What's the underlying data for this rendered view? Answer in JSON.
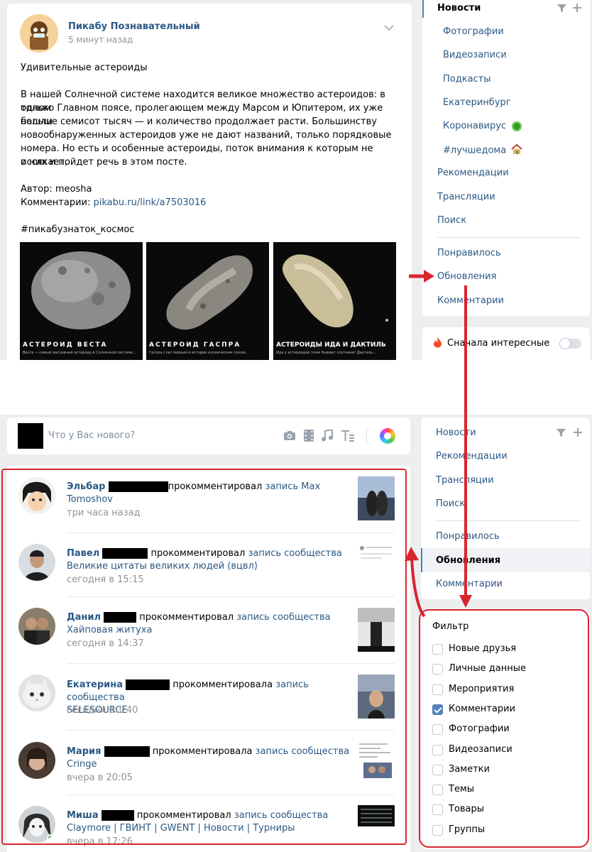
{
  "post": {
    "author": "Пикабу Познавательный",
    "time": "5 минут назад",
    "title": "Удивительные астероиды",
    "body_lines": [
      "В нашей Солнечной системе находится великое множество астероидов: в одном",
      "только Главном поясе, пролегающем между Марсом и Юпитером, их уже нашли",
      "больше семисот тысяч — и количество продолжает расти. Большинству",
      "новообнаруженных астероидов уже не дают названий, только порядковые",
      "номера. Но есть и особенные астероиды, поток внимания к которым не иссякает,",
      "о них и пойдет речь в этом посте."
    ],
    "author_label": "Автор: meosha",
    "comments_label": "Комментарии: ",
    "comments_link": "pikabu.ru/link/a7503016",
    "hashtag": "#пикабузнаток_космос",
    "images": [
      {
        "caption": "АСТЕРОИД ВЕСТА",
        "sub": "Веста — самый массивный астероид в Солнечной системе..."
      },
      {
        "caption": "АСТЕРОИД ГАСПРА",
        "sub": "Гаспра стал первым в истории космическим телом..."
      },
      {
        "caption": "АСТЕРОИДЫ ИДА И ДАКТИЛЬ",
        "sub": "Ида у астероидов тоже бывают спутники! Дактиль..."
      }
    ]
  },
  "top_menu": {
    "news": "Новости",
    "sub_items": [
      "Фотографии",
      "Видеозаписи",
      "Подкасты",
      "Екатеринбург",
      "Коронавирус",
      "#лучшедома"
    ],
    "items": [
      "Рекомендации",
      "Трансляции",
      "Поиск"
    ],
    "items2": [
      "Понравилось",
      "Обновления",
      "Комментарии"
    ],
    "toggle_label": "Сначала интересные"
  },
  "composer": {
    "placeholder": "Что у Вас нового?"
  },
  "side_menu": {
    "news": "Новости",
    "items": [
      "Рекомендации",
      "Трансляции",
      "Поиск"
    ],
    "items2": [
      "Понравилось",
      "Обновления",
      "Комментарии"
    ],
    "active": "Обновления"
  },
  "feed": [
    {
      "name": "Эльбар",
      "action": "прокомментировал",
      "link1": "запись Max",
      "link2": "Tomoshov",
      "time": "три часа назад"
    },
    {
      "name": "Павел",
      "action": "прокомментировал",
      "link1": "запись сообщества",
      "link2": "Великие цитаты великих людей (вцвл)",
      "time": "сегодня в 15:15"
    },
    {
      "name": "Данил",
      "action": "прокомментировал",
      "link1": "запись сообщества",
      "link2": "Хайповая житуха",
      "time": "сегодня в 14:37"
    },
    {
      "name": "Екатерина",
      "action": "прокомментировала",
      "link1": "запись сообщества",
      "link2": "SELESOURCE",
      "time": "сегодня в 1:40"
    },
    {
      "name": "Мария",
      "action": "прокомментировала",
      "link1": "запись сообщества",
      "link2": "Cringe",
      "time": "вчера в 20:05"
    },
    {
      "name": "Миша",
      "action": "прокомментировал",
      "link1": "запись сообщества",
      "link2": "Claymore | ГВИНТ | GWENT | Новости | Турниры",
      "time": "вчера в 17:26"
    }
  ],
  "filter": {
    "title": "Фильтр",
    "options": [
      {
        "label": "Новые друзья",
        "checked": false
      },
      {
        "label": "Личные данные",
        "checked": false
      },
      {
        "label": "Мероприятия",
        "checked": false
      },
      {
        "label": "Комментарии",
        "checked": true
      },
      {
        "label": "Фотографии",
        "checked": false
      },
      {
        "label": "Видеозаписи",
        "checked": false
      },
      {
        "label": "Заметки",
        "checked": false
      },
      {
        "label": "Темы",
        "checked": false
      },
      {
        "label": "Товары",
        "checked": false
      },
      {
        "label": "Группы",
        "checked": false
      }
    ]
  },
  "colors": {
    "accent": "#2a5885",
    "annotation": "#d9252f",
    "bg": "#edeef0",
    "check": "#5181b8"
  }
}
